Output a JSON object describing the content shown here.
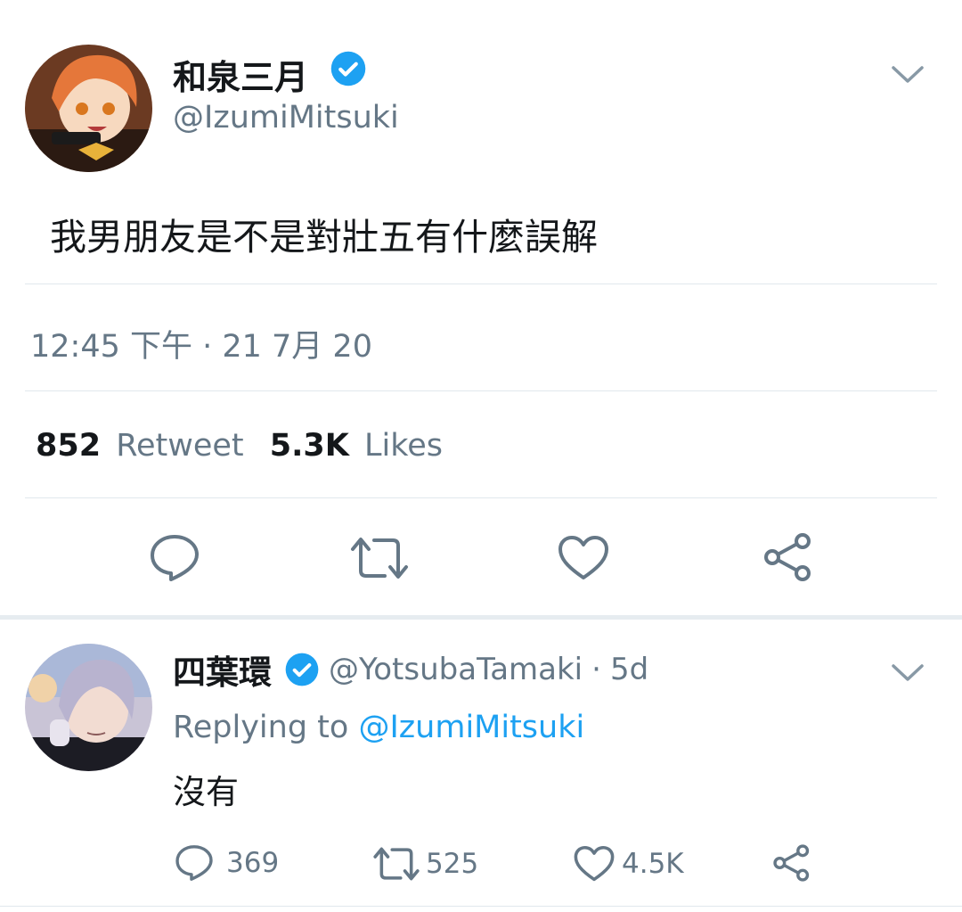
{
  "main_tweet": {
    "display_name": "和泉三月",
    "handle": "@IzumiMitsuki",
    "text": "我男朋友是不是對壯五有什麼誤解",
    "timestamp": "12:45 下午 · 21 7月 20",
    "retweet_count": "852",
    "retweet_label": "Retweet",
    "like_count": "5.3K",
    "like_label": "Likes",
    "verified": true
  },
  "reply": {
    "display_name": "四葉環",
    "handle": "@YotsubaTamaki",
    "time_sep": "·",
    "time": "5d",
    "replying_label": "Replying to",
    "replying_handle": "@IzumiMitsuki",
    "text": "沒有",
    "reply_count": "369",
    "retweet_count": "525",
    "like_count": "4.5K",
    "verified": true
  },
  "icons": [
    "verified-badge-icon",
    "chevron-down-icon",
    "reply-icon",
    "retweet-icon",
    "like-icon",
    "share-icon"
  ],
  "colors": {
    "accent": "#1da1f2",
    "muted": "#657786",
    "divider": "#e1e8ed",
    "text": "#14171a"
  }
}
